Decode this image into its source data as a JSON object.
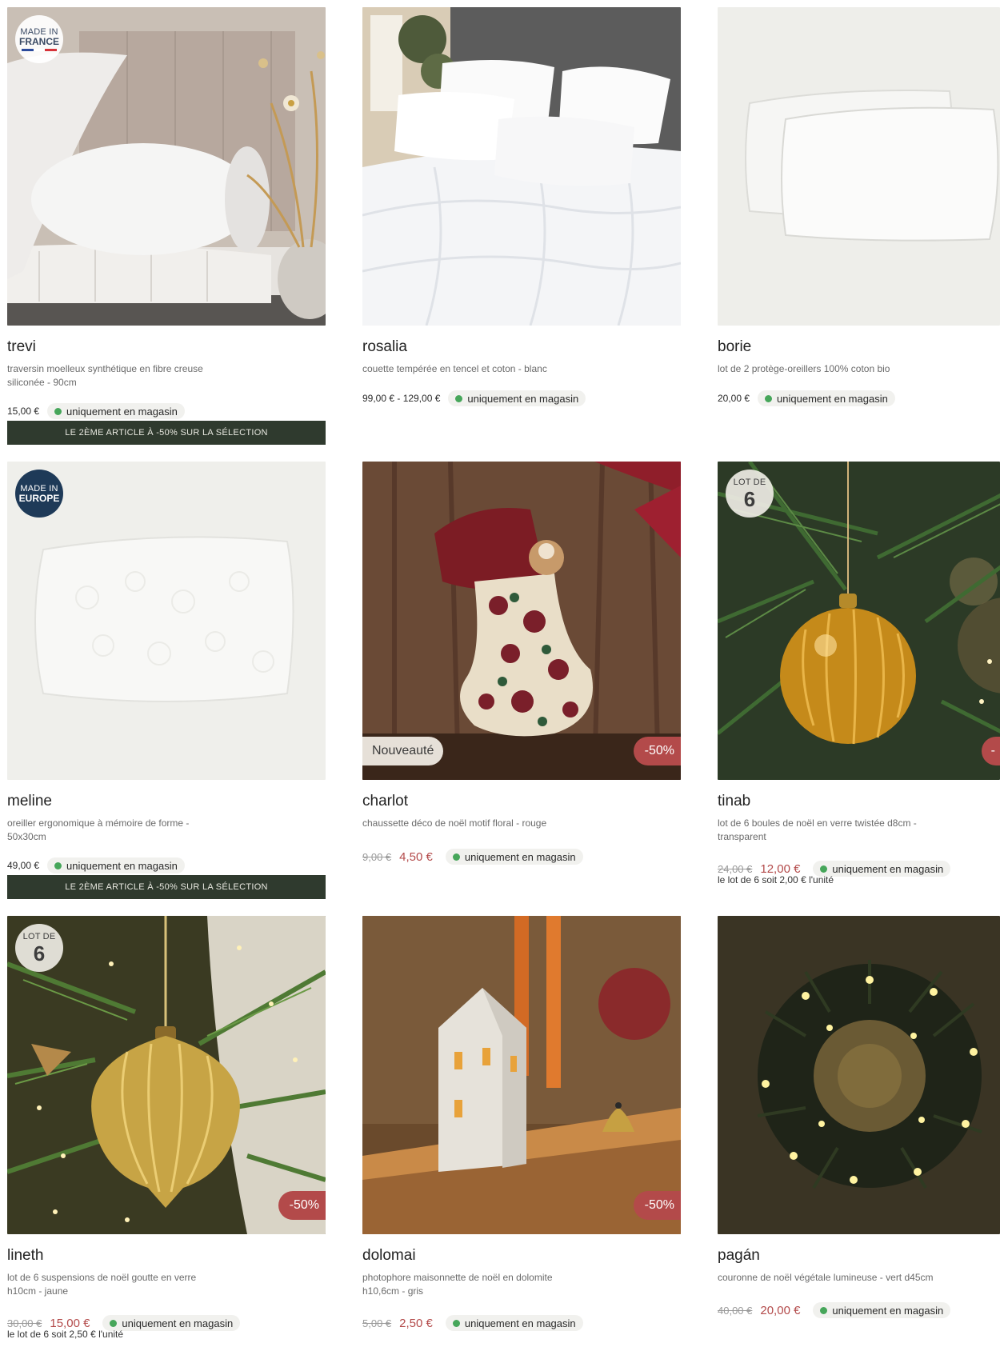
{
  "products": [
    {
      "name": "trevi",
      "description": "traversin moelleux synthétique en fibre creuse siliconée - 90cm",
      "price": "15,00 €",
      "availability": "uniquement en magasin",
      "badge": {
        "line1": "MADE IN",
        "line2": "FRANCE"
      },
      "promo": "LE 2ÈME ARTICLE À -50% SUR LA SÉLECTION",
      "image_icon": "bolster-pillow-image"
    },
    {
      "name": "rosalia",
      "description": "couette tempérée en tencel et coton - blanc",
      "price": "99,00 € - 129,00 €",
      "availability": "uniquement en magasin",
      "image_icon": "duvet-bed-image"
    },
    {
      "name": "borie",
      "description": "lot de 2 protège-oreillers 100% coton bio",
      "price": "20,00 €",
      "availability": "uniquement en magasin",
      "image_icon": "pillow-protectors-image"
    },
    {
      "name": "meline",
      "description": "oreiller ergonomique à mémoire de forme - 50x30cm",
      "price": "49,00 €",
      "availability": "uniquement en magasin",
      "badge": {
        "line1": "MADE IN",
        "line2": "EUROPE"
      },
      "promo": "LE 2ÈME ARTICLE À -50% SUR LA SÉLECTION",
      "image_icon": "memory-foam-pillow-image"
    },
    {
      "name": "charlot",
      "description": "chaussette déco de noël motif floral - rouge",
      "old_price": "9,00 €",
      "new_price": "4,50 €",
      "availability": "uniquement en magasin",
      "new_label": "Nouveauté",
      "discount": "-50%",
      "image_icon": "christmas-stocking-image"
    },
    {
      "name": "tinab",
      "description": "lot de 6 boules de noël en verre twistée d8cm - transparent",
      "old_price": "24,00 €",
      "new_price": "12,00 €",
      "availability": "uniquement en magasin",
      "unit_note": "le lot de 6 soit 2,00 € l'unité",
      "lot": {
        "label": "LOT DE",
        "count": "6"
      },
      "discount": "-",
      "image_icon": "glass-bauble-image"
    },
    {
      "name": "lineth",
      "description": "lot de 6 suspensions de noël goutte en verre h10cm - jaune",
      "old_price": "30,00 €",
      "new_price": "15,00 €",
      "availability": "uniquement en magasin",
      "unit_note": "le lot de 6 soit 2,50 € l'unité",
      "lot": {
        "label": "LOT DE",
        "count": "6"
      },
      "discount": "-50%",
      "image_icon": "drop-ornament-image"
    },
    {
      "name": "dolomai",
      "description": "photophore maisonnette de noël en dolomite h10,6cm - gris",
      "old_price": "5,00 €",
      "new_price": "2,50 €",
      "availability": "uniquement en magasin",
      "discount": "-50%",
      "image_icon": "house-candle-holder-image"
    },
    {
      "name": "pagán",
      "description": "couronne de noël végétale lumineuse - vert d45cm",
      "old_price": "40,00 €",
      "new_price": "20,00 €",
      "availability": "uniquement en magasin",
      "image_icon": "lit-wreath-image"
    }
  ],
  "colors": {
    "accent_red": "#b34a4a",
    "available_green": "#46a65a",
    "promo_bar": "#2f3a2e",
    "made_in_europe_blue": "#1e3a58"
  }
}
